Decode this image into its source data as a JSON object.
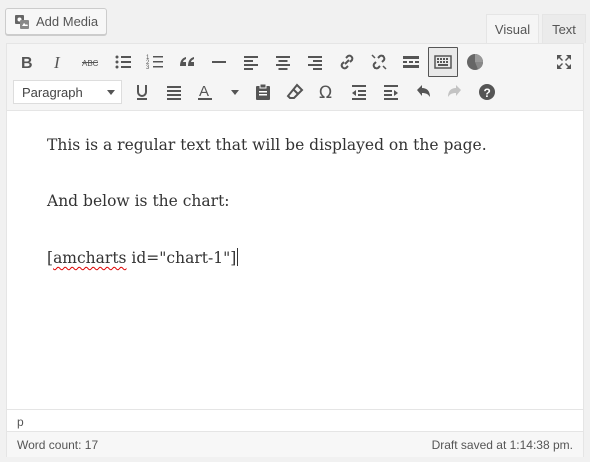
{
  "add_media": {
    "label": "Add Media",
    "icon": "media-icon"
  },
  "tabs": [
    {
      "label": "Visual"
    },
    {
      "label": "Text"
    }
  ],
  "toolbar": {
    "format_select": {
      "value": "Paragraph"
    },
    "row1": [
      "bold",
      "italic",
      "strikethrough",
      "bulleted-list",
      "numbered-list",
      "blockquote",
      "horizontal-line",
      "align-left",
      "align-center",
      "align-right",
      "insert-link",
      "remove-link",
      "read-more",
      "toolbar-toggle",
      "amcharts",
      "fullscreen"
    ],
    "row2": [
      "underline",
      "justify",
      "text-color",
      "paste-as-text",
      "clear-formatting",
      "special-character",
      "decrease-indent",
      "increase-indent",
      "undo",
      "redo",
      "help"
    ]
  },
  "content": {
    "line1": "This is a regular text that will be displayed on the page.",
    "line2": "And below is the chart:",
    "line3_prefix": "[",
    "line3_spell": "amcharts",
    "line3_rest": " id=\"chart-1\"]"
  },
  "pathbar": {
    "path": "p"
  },
  "status": {
    "word_count": "Word count: 17",
    "draft": "Draft saved at 1:14:38 pm."
  }
}
